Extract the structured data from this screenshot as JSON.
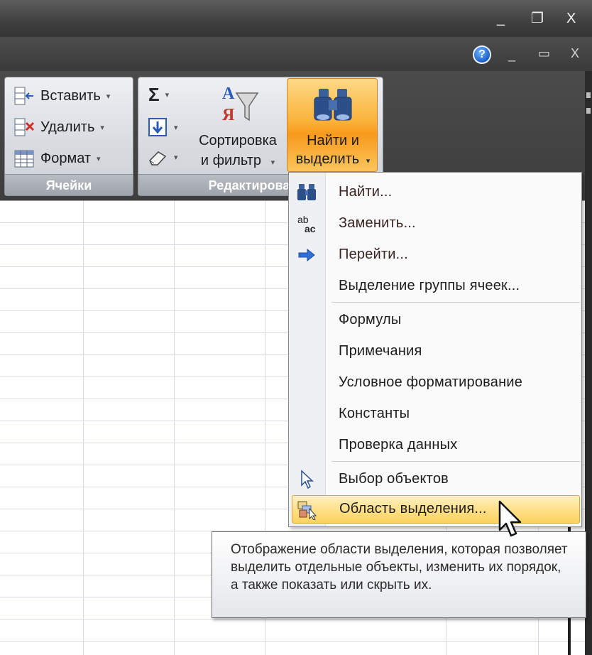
{
  "window": {
    "restore_glyph": "❐",
    "close_glyph": "X",
    "minimize_glyph": "_"
  },
  "menubar": {
    "help_glyph": "?",
    "minimize_glyph": "_",
    "restore_glyph": "▭",
    "close_glyph": "X"
  },
  "ribbon": {
    "cells_group": {
      "label": "Ячейки",
      "insert": "Вставить",
      "delete": "Удалить",
      "format": "Формат"
    },
    "editing_group": {
      "label": "Редактирование",
      "sum_glyph": "Σ",
      "sort_filter_line1": "Сортировка",
      "sort_filter_line2": "и фильтр",
      "find_select_line1": "Найти и",
      "find_select_line2": "выделить",
      "dropdown_glyph": "▾"
    }
  },
  "menu": {
    "items": [
      {
        "label": "Найти...",
        "icon": "binoculars-icon"
      },
      {
        "label": "Заменить...",
        "icon": "replace-icon"
      },
      {
        "label": "Перейти...",
        "icon": "arrow-right-icon"
      },
      {
        "label": "Выделение группы ячеек...",
        "icon": ""
      },
      {
        "label": "Формулы",
        "icon": ""
      },
      {
        "label": "Примечания",
        "icon": ""
      },
      {
        "label": "Условное форматирование",
        "icon": ""
      },
      {
        "label": "Константы",
        "icon": ""
      },
      {
        "label": "Проверка данных",
        "icon": ""
      },
      {
        "label": "Выбор объектов",
        "icon": "pointer-icon"
      },
      {
        "label": "Область выделения...",
        "icon": "selection-pane-icon"
      }
    ],
    "replace_icon_top": "ab",
    "replace_icon_bottom": "ac"
  },
  "tooltip": {
    "text": "Отображение области выделения, которая позволяет выделить отдельные объекты, изменить их порядок, а также показать или скрыть их."
  },
  "colors": {
    "highlight": "#fcd35f",
    "find_button": "#f89a1c",
    "ribbon_dark": "#3d3d3d"
  }
}
